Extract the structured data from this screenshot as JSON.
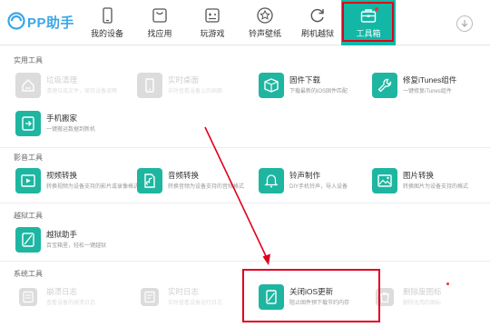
{
  "app": {
    "logo_text": "PP助手"
  },
  "nav": [
    {
      "label": "我的设备",
      "icon": "phone-icon"
    },
    {
      "label": "找应用",
      "icon": "shopping-bag-icon"
    },
    {
      "label": "玩游戏",
      "icon": "gamepad-icon"
    },
    {
      "label": "铃声壁纸",
      "icon": "star-icon"
    },
    {
      "label": "刷机越狱",
      "icon": "refresh-icon"
    },
    {
      "label": "工具箱",
      "icon": "toolbox-icon",
      "active": true
    }
  ],
  "sections": [
    {
      "title": "实用工具",
      "tools": [
        {
          "name": "垃圾清理",
          "desc": "清理垃圾文件，保持设备流畅",
          "enabled": false,
          "icon": "broom-icon"
        },
        {
          "name": "实时桌面",
          "desc": "实时查看设备上的画面",
          "enabled": false,
          "icon": "desktop-icon"
        },
        {
          "name": "固件下载",
          "desc": "下载最新的iOS固件匹配",
          "enabled": true,
          "icon": "box-icon"
        },
        {
          "name": "修复iTunes组件",
          "desc": "一键修复iTunes组件",
          "enabled": true,
          "icon": "wrench-icon"
        },
        {
          "name": "手机搬家",
          "desc": "一键搬运数据到新机",
          "enabled": true,
          "icon": "transfer-icon"
        }
      ]
    },
    {
      "title": "影音工具",
      "tools": [
        {
          "name": "视频转换",
          "desc": "转换视频为设备支持的影片或录像格式",
          "enabled": true,
          "icon": "video-icon"
        },
        {
          "name": "音频转换",
          "desc": "转换音频为设备支持的音频格式",
          "enabled": true,
          "icon": "audio-icon"
        },
        {
          "name": "铃声制作",
          "desc": "DIY手机铃声，导入设备",
          "enabled": true,
          "icon": "bell-icon"
        },
        {
          "name": "图片转换",
          "desc": "转换图片为设备支持的格式",
          "enabled": true,
          "icon": "image-icon"
        }
      ]
    },
    {
      "title": "越狱工具",
      "tools": [
        {
          "name": "越狱助手",
          "desc": "百宝箱里，轻松一键越狱",
          "enabled": true,
          "icon": "jailbreak-icon"
        }
      ]
    },
    {
      "title": "系统工具",
      "tools": [
        {
          "name": "崩溃日志",
          "desc": "查看设备的崩溃日志",
          "enabled": false,
          "icon": "log-icon"
        },
        {
          "name": "实时日志",
          "desc": "实时查看设备运行日志",
          "enabled": false,
          "icon": "realtime-log-icon"
        },
        {
          "name": "关闭iOS更新",
          "desc": "阻止固件预下载节约内存",
          "enabled": true,
          "icon": "no-update-icon"
        },
        {
          "name": "删除废图标",
          "desc": "删除无用的图标",
          "enabled": false,
          "icon": "trash-icon"
        }
      ]
    }
  ],
  "colors": {
    "accent": "#12b7a5",
    "icon_bg": "#1eb6a0",
    "highlight": "#e0001b",
    "logo": "#3aa6e8"
  }
}
